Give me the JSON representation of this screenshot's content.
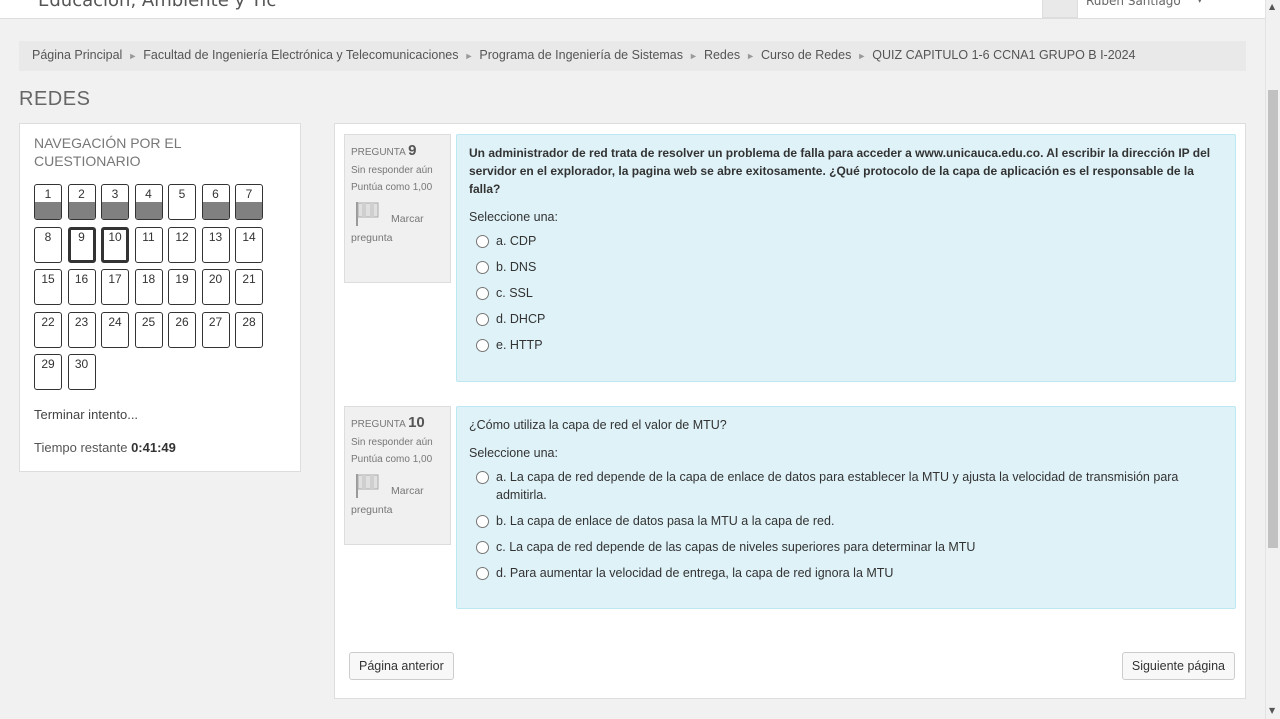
{
  "header": {
    "site_title": "Educación, Ambiente y Tic",
    "user_name": "Rubén Santiago",
    "user_caret": "▾"
  },
  "breadcrumb": [
    "Página Principal",
    "Facultad de Ingeniería Electrónica y Telecomunicaciones",
    "Programa de Ingeniería de Sistemas",
    "Redes",
    "Curso de Redes",
    "QUIZ CAPITULO 1-6 CCNA1 GRUPO B I-2024"
  ],
  "page_heading": "REDES",
  "quiz_nav": {
    "title": "NAVEGACIÓN POR EL CUESTIONARIO",
    "answered_questions": [
      1,
      2,
      3,
      4,
      6,
      7
    ],
    "current_questions": [
      9,
      10
    ],
    "question_numbers": [
      "1",
      "2",
      "3",
      "4",
      "5",
      "6",
      "7",
      "8",
      "9",
      "10",
      "11",
      "12",
      "13",
      "14",
      "15",
      "16",
      "17",
      "18",
      "19",
      "20",
      "21",
      "22",
      "23",
      "24",
      "25",
      "26",
      "27",
      "28",
      "29",
      "30"
    ],
    "finish_link": "Terminar intento...",
    "time_label": "Tiempo restante",
    "time_value": "0:41:49"
  },
  "questions": [
    {
      "label": "PREGUNTA",
      "number": "9",
      "status": "Sin responder aún",
      "points": "Puntúa como 1,00",
      "flag_label_1": "Marcar",
      "flag_label_2": "pregunta",
      "text": "Un administrador de red trata de resolver un problema de falla para acceder a www.unicauca.edu.co. Al escribir la dirección IP del servidor en el explorador, la pagina web se abre exitosamente. ¿Qué protocolo de la capa de aplicación es el responsable de la falla?",
      "prompt": "Seleccione una:",
      "options": [
        "a. CDP",
        "b. DNS",
        "c. SSL",
        "d. DHCP",
        "e. HTTP"
      ]
    },
    {
      "label": "PREGUNTA",
      "number": "10",
      "status": "Sin responder aún",
      "points": "Puntúa como 1,00",
      "flag_label_1": "Marcar",
      "flag_label_2": "pregunta",
      "text": "¿Cómo utiliza la capa de red el valor de MTU?",
      "prompt": "Seleccione una:",
      "options": [
        "a. La capa de red depende de la capa de enlace de datos para establecer la MTU y ajusta la velocidad de transmisión para admitirla.",
        "b. La capa de enlace de datos pasa la MTU a la capa de red.",
        "c. La capa de red depende de las capas de niveles superiores para determinar la MTU",
        "d. Para aumentar la velocidad de entrega, la capa de red ignora la MTU"
      ]
    }
  ],
  "buttons": {
    "previous_page": "Página anterior",
    "next_page": "Siguiente página"
  },
  "icons": {
    "flag": "flag-icon",
    "breadcrumb_separator": "►",
    "scroll_up": "▲",
    "scroll_down": "▼"
  }
}
